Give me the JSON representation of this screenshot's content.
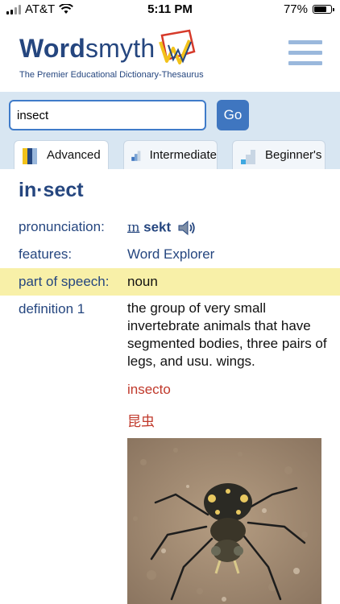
{
  "status_bar": {
    "carrier": "AT&T",
    "time": "5:11 PM",
    "battery": "77%",
    "battery_level": 0.77
  },
  "header": {
    "logo_bold": "Word",
    "logo_light": "smyth",
    "tagline": "The Premier Educational Dictionary-Thesaurus"
  },
  "search": {
    "query": "insect",
    "go_label": "Go"
  },
  "tabs": [
    {
      "label": "Advanced",
      "active": true
    },
    {
      "label": "Intermediate",
      "active": false
    },
    {
      "label": "Beginner's",
      "active": false
    }
  ],
  "entry": {
    "headword": "in·sect",
    "pronunciation_label": "pronunciation:",
    "pronunciation_stressed": "ɪn",
    "pronunciation_rest": " sekt",
    "features_label": "features:",
    "features_value": "Word Explorer",
    "pos_label": "part of speech:",
    "pos_value": "noun",
    "definition_label": "definition 1",
    "definition_text": "the group of very small invertebrate animals that have segmented bodies, three pairs of legs, and usu. wings.",
    "translation_spanish": "insecto",
    "translation_chinese": "昆虫"
  },
  "colors": {
    "brand": "#25467f",
    "accent": "#3f76c0",
    "highlight": "#f8f0a8",
    "translation": "#c0392b"
  }
}
